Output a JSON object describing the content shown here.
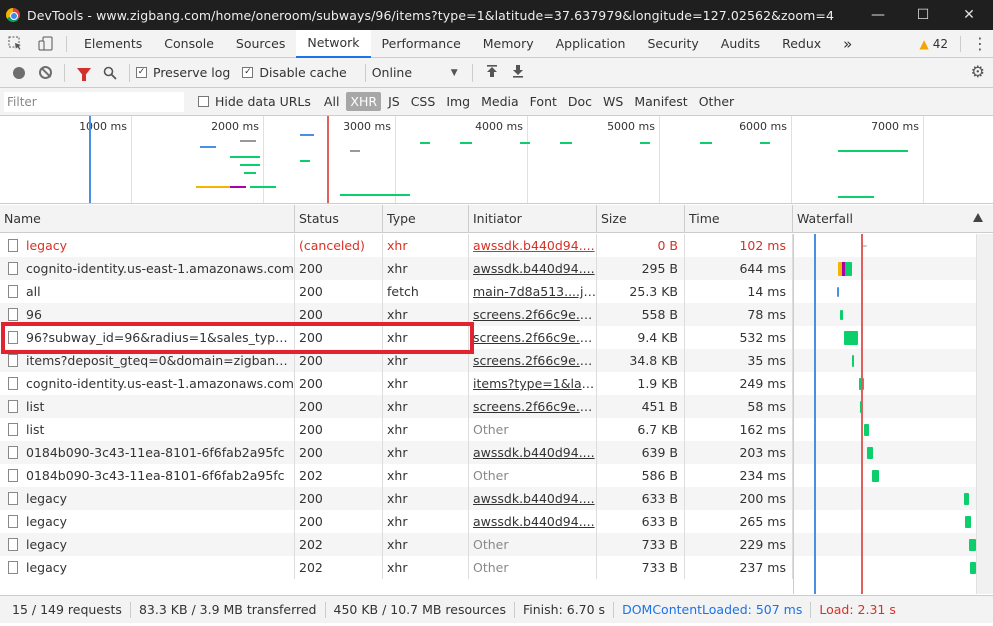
{
  "window": {
    "title": "DevTools - www.zigbang.com/home/oneroom/subways/96/items?type=1&latitude=37.637979&longitude=127.02562&zoom=4",
    "minimize": "—",
    "maximize": "☐",
    "close": "✕"
  },
  "tabs": {
    "items": [
      "Elements",
      "Console",
      "Sources",
      "Network",
      "Performance",
      "Memory",
      "Application",
      "Security",
      "Audits",
      "Redux"
    ],
    "active": "Network",
    "more": "»",
    "warnings": "42"
  },
  "toolbar": {
    "preserve_log": "Preserve log",
    "disable_cache": "Disable cache",
    "throttle": "Online",
    "checkmark": "✓"
  },
  "filter": {
    "placeholder": "Filter",
    "hide_data_urls": "Hide data URLs",
    "types": [
      "All",
      "XHR",
      "JS",
      "CSS",
      "Img",
      "Media",
      "Font",
      "Doc",
      "WS",
      "Manifest",
      "Other"
    ],
    "active_type": "XHR"
  },
  "overview": {
    "ticks": [
      "1000 ms",
      "2000 ms",
      "3000 ms",
      "4000 ms",
      "5000 ms",
      "6000 ms",
      "7000 ms"
    ]
  },
  "columns": {
    "name": "Name",
    "status": "Status",
    "type": "Type",
    "initiator": "Initiator",
    "size": "Size",
    "time": "Time",
    "waterfall": "Waterfall"
  },
  "rows": [
    {
      "name": "legacy",
      "status": "(canceled)",
      "type": "xhr",
      "initiator": "awssdk.b440d94....",
      "initiator_link": true,
      "size": "0 B",
      "time": "102 ms",
      "error": true
    },
    {
      "name": "cognito-identity.us-east-1.amazonaws.com",
      "status": "200",
      "type": "xhr",
      "initiator": "awssdk.b440d94....",
      "initiator_link": true,
      "size": "295 B",
      "time": "644 ms"
    },
    {
      "name": "all",
      "status": "200",
      "type": "fetch",
      "initiator": "main-7d8a513....js:1",
      "initiator_link": true,
      "size": "25.3 KB",
      "time": "14 ms"
    },
    {
      "name": "96",
      "status": "200",
      "type": "xhr",
      "initiator": "screens.2f66c9e....j...",
      "initiator_link": true,
      "size": "558 B",
      "time": "78 ms"
    },
    {
      "name": "96?subway_id=96&radius=1&sales_type=&...",
      "status": "200",
      "type": "xhr",
      "initiator": "screens.2f66c9e....j...",
      "initiator_link": true,
      "size": "9.4 KB",
      "time": "532 ms"
    },
    {
      "name": "items?deposit_gteq=0&domain=zigbang&...",
      "status": "200",
      "type": "xhr",
      "initiator": "screens.2f66c9e....j...",
      "initiator_link": true,
      "size": "34.8 KB",
      "time": "35 ms"
    },
    {
      "name": "cognito-identity.us-east-1.amazonaws.com",
      "status": "200",
      "type": "xhr",
      "initiator": "items?type=1&lati...",
      "initiator_link": true,
      "size": "1.9 KB",
      "time": "249 ms"
    },
    {
      "name": "list",
      "status": "200",
      "type": "xhr",
      "initiator": "screens.2f66c9e....j...",
      "initiator_link": true,
      "size": "451 B",
      "time": "58 ms"
    },
    {
      "name": "list",
      "status": "200",
      "type": "xhr",
      "initiator": "Other",
      "initiator_link": false,
      "size": "6.7 KB",
      "time": "162 ms"
    },
    {
      "name": "0184b090-3c43-11ea-8101-6f6fab2a95fc",
      "status": "200",
      "type": "xhr",
      "initiator": "awssdk.b440d94....",
      "initiator_link": true,
      "size": "639 B",
      "time": "203 ms"
    },
    {
      "name": "0184b090-3c43-11ea-8101-6f6fab2a95fc",
      "status": "202",
      "type": "xhr",
      "initiator": "Other",
      "initiator_link": false,
      "size": "586 B",
      "time": "234 ms"
    },
    {
      "name": "legacy",
      "status": "200",
      "type": "xhr",
      "initiator": "awssdk.b440d94....",
      "initiator_link": true,
      "size": "633 B",
      "time": "200 ms"
    },
    {
      "name": "legacy",
      "status": "200",
      "type": "xhr",
      "initiator": "awssdk.b440d94....",
      "initiator_link": true,
      "size": "633 B",
      "time": "265 ms"
    },
    {
      "name": "legacy",
      "status": "202",
      "type": "xhr",
      "initiator": "Other",
      "initiator_link": false,
      "size": "733 B",
      "time": "229 ms"
    },
    {
      "name": "legacy",
      "status": "202",
      "type": "xhr",
      "initiator": "Other",
      "initiator_link": false,
      "size": "733 B",
      "time": "237 ms"
    }
  ],
  "status_bar": {
    "requests": "15 / 149 requests",
    "transferred": "83.3 KB / 3.9 MB transferred",
    "resources": "450 KB / 10.7 MB resources",
    "finish": "Finish: 6.70 s",
    "dom_loaded": "DOMContentLoaded: 507 ms",
    "load": "Load: 2.31 s"
  },
  "colors": {
    "accent": "#1a73e8",
    "error": "#d93025",
    "highlight": "#e0232e",
    "waterfall_green": "#0cce6b",
    "dom_line": "#4a90e2",
    "load_line": "#e06060"
  }
}
